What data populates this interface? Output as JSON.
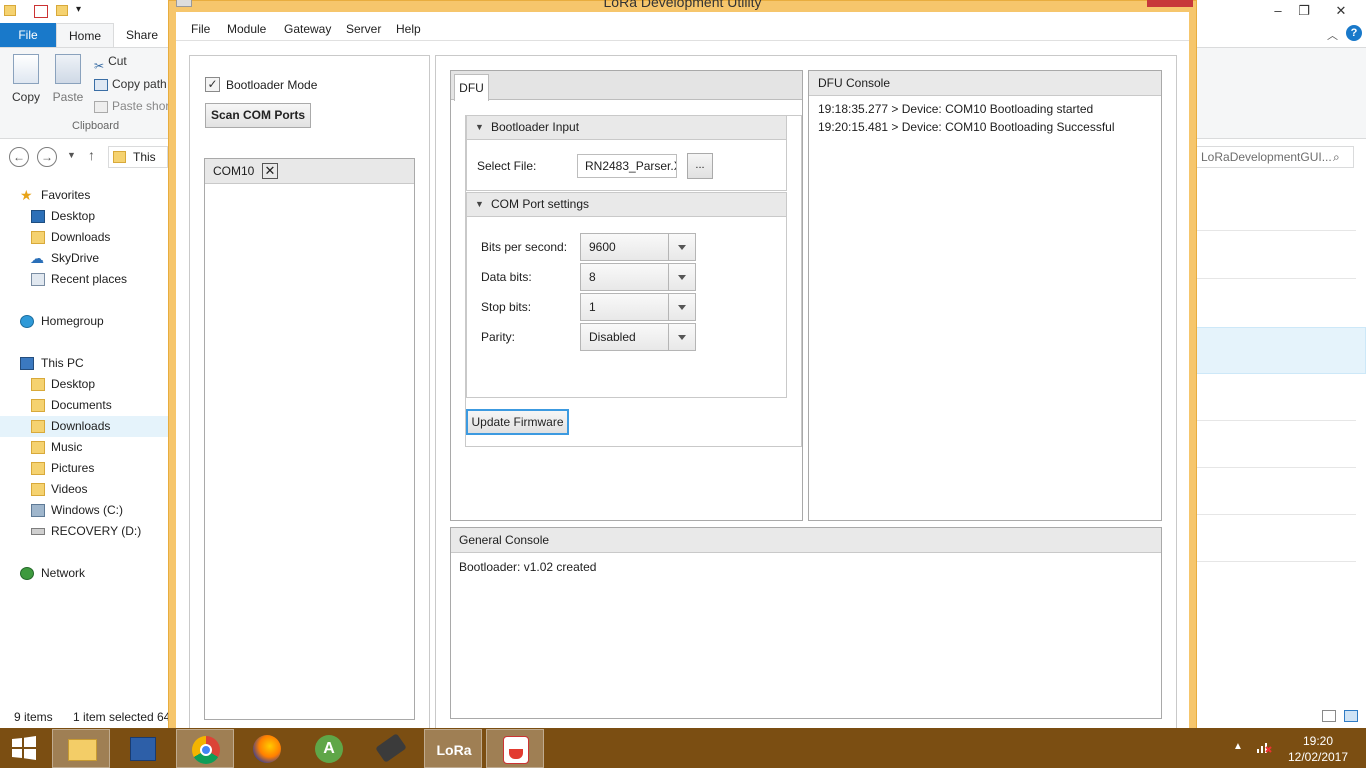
{
  "explorer": {
    "tabs": {
      "file": "File",
      "home": "Home",
      "share": "Share"
    },
    "ribbon": {
      "copy": "Copy",
      "paste": "Paste",
      "cut": "Cut",
      "copy_path": "Copy path",
      "paste_shortcut": "Paste shor",
      "group_label": "Clipboard"
    },
    "address_text": "This",
    "search_text": "LoRaDevelopmentGUI...",
    "nav": {
      "favorites": "Favorites",
      "desktop": "Desktop",
      "downloads": "Downloads",
      "skydrive": "SkyDrive",
      "recent_places": "Recent places",
      "homegroup": "Homegroup",
      "this_pc": "This PC",
      "pc_desktop": "Desktop",
      "documents": "Documents",
      "pc_downloads": "Downloads",
      "music": "Music",
      "pictures": "Pictures",
      "videos": "Videos",
      "windows_c": "Windows (C:)",
      "recovery_d": "RECOVERY (D:)",
      "network": "Network"
    },
    "status": {
      "items": "9 items",
      "selected": "1 item selected",
      "size": "64"
    }
  },
  "app": {
    "title": "LoRa Development Utility",
    "menu": {
      "file": "File",
      "module": "Module",
      "gateway": "Gateway",
      "server": "Server",
      "help": "Help"
    },
    "left": {
      "bootloader_mode_label": "Bootloader Mode",
      "bootloader_mode_checked": true,
      "check_glyph": "✓",
      "scan_button": "Scan COM Ports",
      "com_tab": "COM10",
      "com_tab_close": "✕"
    },
    "dfu": {
      "tab": "DFU",
      "bootloader_section": "Bootloader Input",
      "select_file_label": "Select File:",
      "select_file_value": "RN2483_Parser.X",
      "browse_button": "...",
      "com_section": "COM Port settings",
      "bits_per_second_label": "Bits per second:",
      "bits_per_second_value": "9600",
      "data_bits_label": "Data bits:",
      "data_bits_value": "8",
      "stop_bits_label": "Stop bits:",
      "stop_bits_value": "1",
      "parity_label": "Parity:",
      "parity_value": "Disabled",
      "update_button": "Update Firmware",
      "section_arrow": "▼"
    },
    "dfu_console": {
      "title": "DFU Console",
      "lines": [
        "19:18:35.277 > Device: COM10 Bootloading started",
        "19:20:15.481 > Device: COM10 Bootloading Successful"
      ]
    },
    "general_console": {
      "title": "General Console",
      "lines": [
        "Bootloader: v1.02 created"
      ]
    }
  },
  "taskbar": {
    "time": "19:20",
    "date": "12/02/2017",
    "lora_icon_text": "LoRa",
    "tray_arrow": "▲"
  },
  "window_controls": {
    "minimize": "–",
    "restore": "❐",
    "close": "✕"
  },
  "colors": {
    "lora_frame": "#f6c66c",
    "taskbar": "#7b4e12",
    "file_tab": "#1979ca",
    "focus_blue": "#3c9ae0"
  }
}
